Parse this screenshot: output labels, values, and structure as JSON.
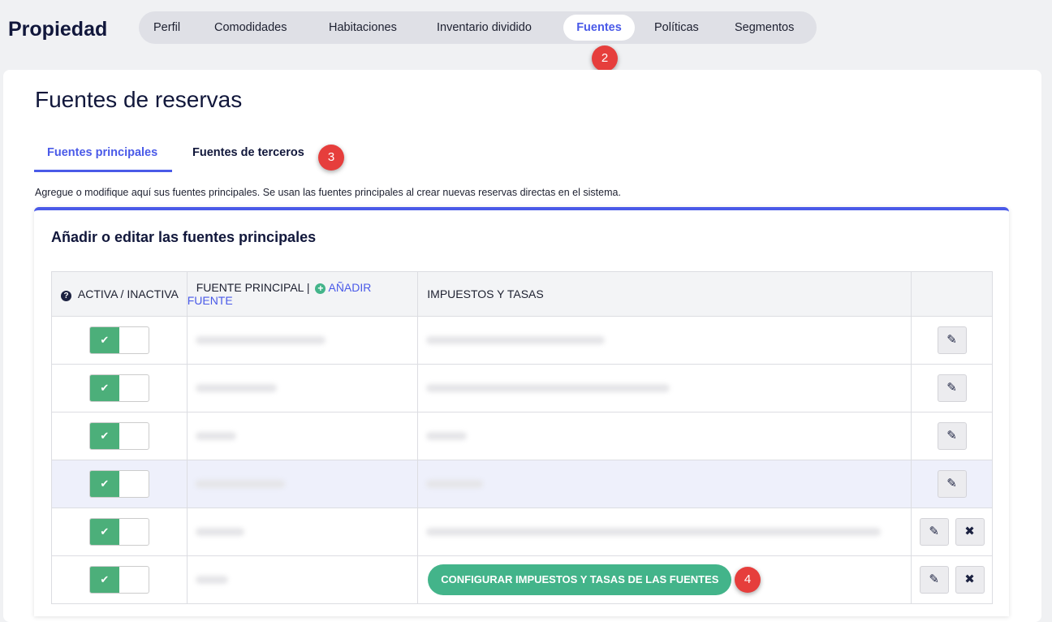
{
  "brand": "Propiedad",
  "nav": {
    "tabs": [
      "Perfil",
      "Comodidades",
      "Habitaciones",
      "Inventario dividido",
      "Fuentes",
      "Políticas",
      "Segmentos"
    ],
    "active": "Fuentes"
  },
  "badges": [
    "2",
    "3",
    "4"
  ],
  "page_title": "Fuentes de reservas",
  "subtabs": [
    "Fuentes principales",
    "Fuentes de terceros"
  ],
  "description": "Agregue o modifique aquí sus fuentes principales. Se usan las fuentes principales al crear nuevas reservas directas en el sistema.",
  "panel_title": "Añadir o editar las fuentes principales",
  "table": {
    "col_active": "ACTIVA / INACTIVA",
    "col_source": "FUENTE PRINCIPAL |",
    "add_source": "AÑADIR FUENTE",
    "col_taxes": "IMPUESTOS Y TASAS"
  },
  "configure_button": "CONFIGURAR IMPUESTOS Y TASAS DE LAS FUENTES",
  "colors": {
    "accent": "#4a5ae8",
    "toggle_on": "#4caf7a",
    "badge": "#e63e3c",
    "config_button": "#43b48a"
  }
}
